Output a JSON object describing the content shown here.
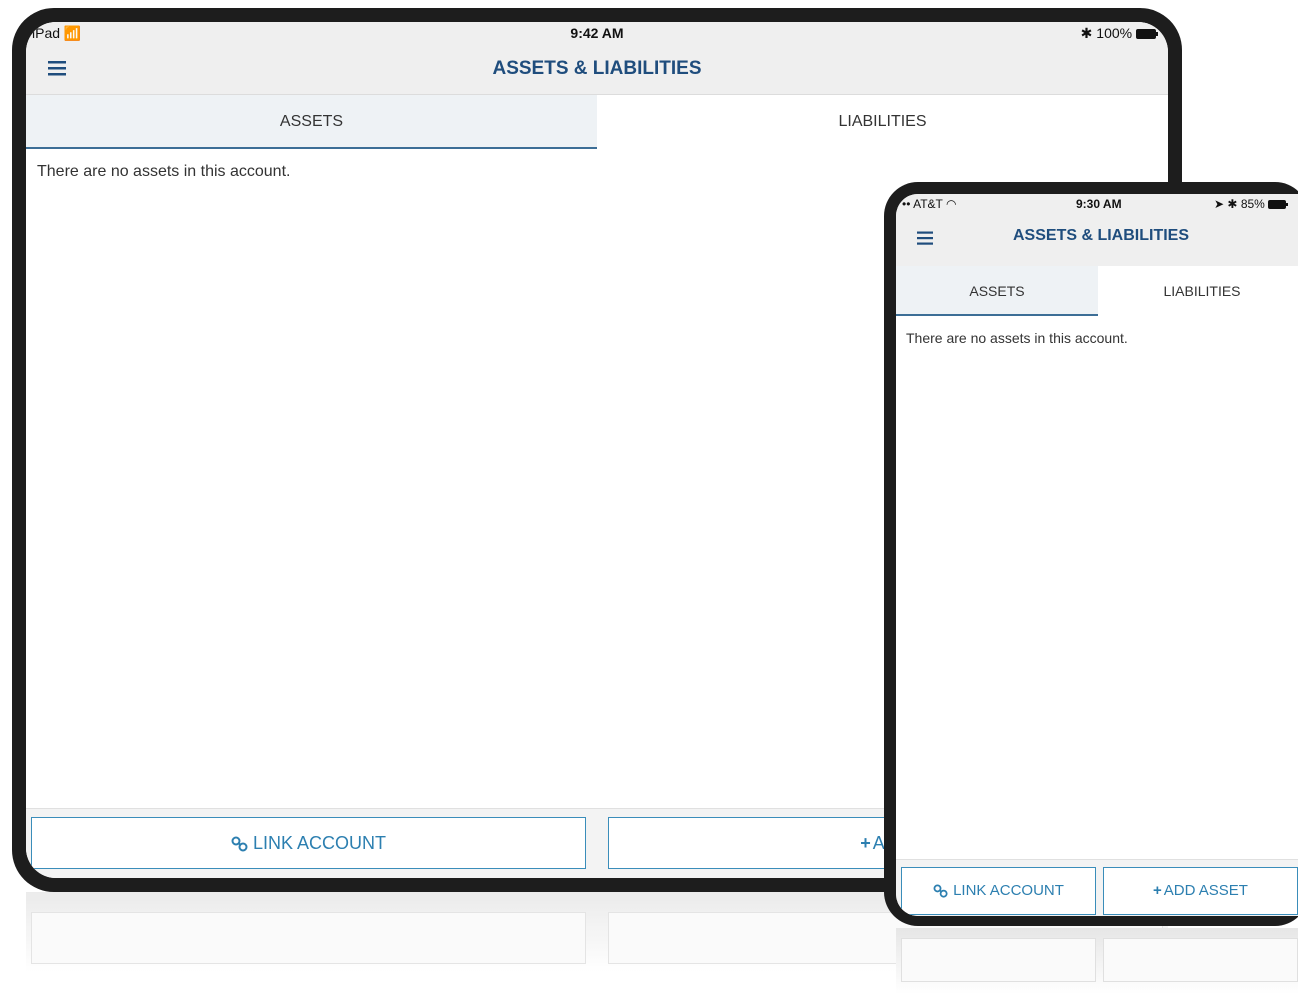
{
  "ipad": {
    "status": {
      "carrier": "iPad",
      "time": "9:42 AM",
      "battery": "100%"
    },
    "nav_title": "ASSETS & LIABILITIES",
    "tabs": [
      {
        "label": "ASSETS"
      },
      {
        "label": "LIABILITIES"
      }
    ],
    "empty_message": "There are no assets in this account.",
    "buttons": {
      "link_account": "LINK ACCOUNT",
      "add": "ADD"
    }
  },
  "iphone": {
    "status": {
      "carrier": "AT&T",
      "time": "9:30 AM",
      "battery": "85%"
    },
    "nav_title": "ASSETS & LIABILITIES",
    "tabs": [
      {
        "label": "ASSETS"
      },
      {
        "label": "LIABILITIES"
      }
    ],
    "empty_message": "There are no assets in this account.",
    "buttons": {
      "link_account": "LINK ACCOUNT",
      "add_asset": "ADD ASSET"
    }
  },
  "colors": {
    "nav_title": "#1f4d7d",
    "button_text": "#2c7fb0",
    "button_border": "#3a8dba",
    "active_tab_bg": "#eef2f5",
    "active_tab_underline": "#3c6e96",
    "device_frame": "#1d1d1d"
  }
}
